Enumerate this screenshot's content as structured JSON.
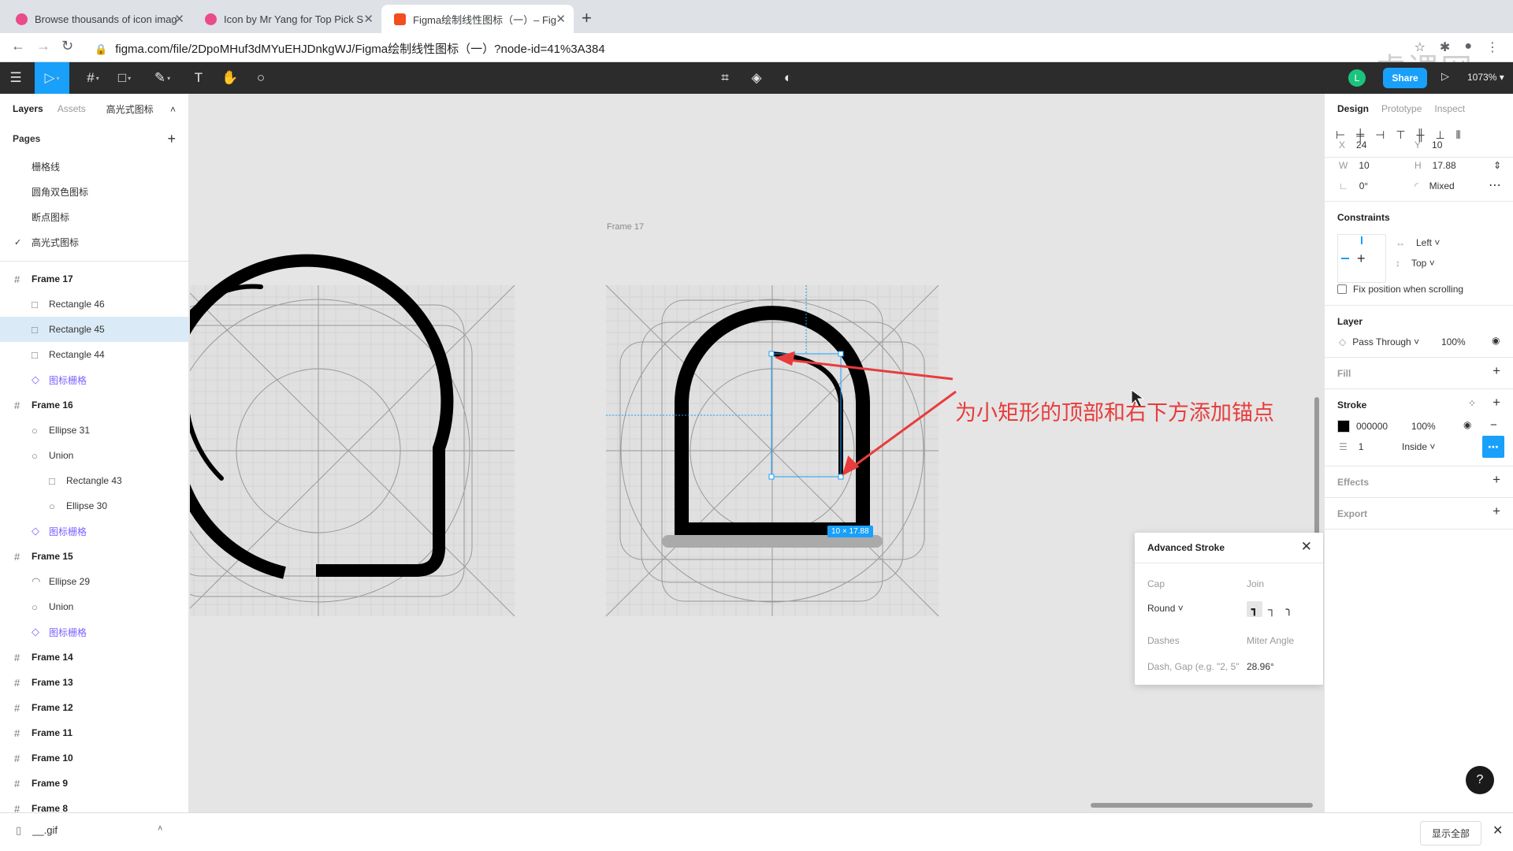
{
  "browser": {
    "tabs": [
      {
        "title": "Browse thousands of icon imag",
        "active": false,
        "favicon_color": "#ea4c89"
      },
      {
        "title": "Icon by Mr Yang for Top Pick S",
        "active": false,
        "favicon_color": "#ea4c89"
      },
      {
        "title": "Figma绘制线性图标（一）– Fig",
        "active": true,
        "favicon_color": "#f24e1e"
      }
    ],
    "url": "figma.com/file/2DpoMHuf3dMYuEHJDnkgWJ/Figma绘制线性图标（一）?node-id=41%3A384",
    "watermark": "虎课网"
  },
  "toolbar": {
    "share_label": "Share",
    "zoom": "1073%",
    "avatar_initial": "L",
    "accent": "#18a0fb"
  },
  "left_panel": {
    "tab_layers": "Layers",
    "tab_assets": "Assets",
    "current_page_selector": "高光式图标",
    "pages_title": "Pages",
    "pages": [
      {
        "name": "栅格线",
        "current": false
      },
      {
        "name": "圆角双色图标",
        "current": false
      },
      {
        "name": "断点图标",
        "current": false
      },
      {
        "name": "高光式图标",
        "current": true
      }
    ],
    "layers": [
      {
        "name": "Frame 17",
        "type": "frame",
        "depth": 0
      },
      {
        "name": "Rectangle 46",
        "type": "rect",
        "depth": 1
      },
      {
        "name": "Rectangle 45",
        "type": "rect",
        "depth": 1,
        "selected": true
      },
      {
        "name": "Rectangle 44",
        "type": "rect",
        "depth": 1
      },
      {
        "name": "图标栅格",
        "type": "component",
        "depth": 1
      },
      {
        "name": "Frame 16",
        "type": "frame",
        "depth": 0
      },
      {
        "name": "Ellipse 31",
        "type": "ellipse",
        "depth": 1
      },
      {
        "name": "Union",
        "type": "union",
        "depth": 1
      },
      {
        "name": "Rectangle 43",
        "type": "rect",
        "depth": 2
      },
      {
        "name": "Ellipse 30",
        "type": "ellipse",
        "depth": 2
      },
      {
        "name": "图标栅格",
        "type": "component",
        "depth": 1
      },
      {
        "name": "Frame 15",
        "type": "frame",
        "depth": 0
      },
      {
        "name": "Ellipse 29",
        "type": "arc",
        "depth": 1
      },
      {
        "name": "Union",
        "type": "union",
        "depth": 1
      },
      {
        "name": "图标栅格",
        "type": "component",
        "depth": 1
      },
      {
        "name": "Frame 14",
        "type": "frame",
        "depth": 0
      },
      {
        "name": "Frame 13",
        "type": "frame",
        "depth": 0
      },
      {
        "name": "Frame 12",
        "type": "frame",
        "depth": 0
      },
      {
        "name": "Frame 11",
        "type": "frame",
        "depth": 0
      },
      {
        "name": "Frame 10",
        "type": "frame",
        "depth": 0
      },
      {
        "name": "Frame 9",
        "type": "frame",
        "depth": 0
      },
      {
        "name": "Frame 8",
        "type": "frame",
        "depth": 0
      }
    ]
  },
  "canvas": {
    "frame_label": "Frame 17",
    "annotation": "为小矩形的顶部和右下方添加锚点",
    "annotation_color": "#e83c3c",
    "dimension_label": "10 × 17.88"
  },
  "advanced_stroke": {
    "title": "Advanced Stroke",
    "cap_label": "Cap",
    "join_label": "Join",
    "cap_value": "Round",
    "dashes_label": "Dashes",
    "miter_label": "Miter Angle",
    "dashes_placeholder": "Dash, Gap (e.g. \"2, 5\"",
    "miter_value": "28.96°"
  },
  "right_panel": {
    "tab_design": "Design",
    "tab_prototype": "Prototype",
    "tab_inspect": "Inspect",
    "x": "24",
    "y": "10",
    "w": "10",
    "h": "17.88",
    "rotation": "0°",
    "radius": "Mixed",
    "constraints_title": "Constraints",
    "constraint_h": "Left",
    "constraint_v": "Top",
    "fix_position": "Fix position when scrolling",
    "layer_title": "Layer",
    "blend": "Pass Through",
    "opacity": "100%",
    "fill_title": "Fill",
    "stroke_title": "Stroke",
    "stroke_color": "000000",
    "stroke_opacity": "100%",
    "stroke_weight": "1",
    "stroke_align": "Inside",
    "effects_title": "Effects",
    "export_title": "Export"
  },
  "downloads": {
    "file": "__.gif",
    "show_all": "显示全部"
  }
}
